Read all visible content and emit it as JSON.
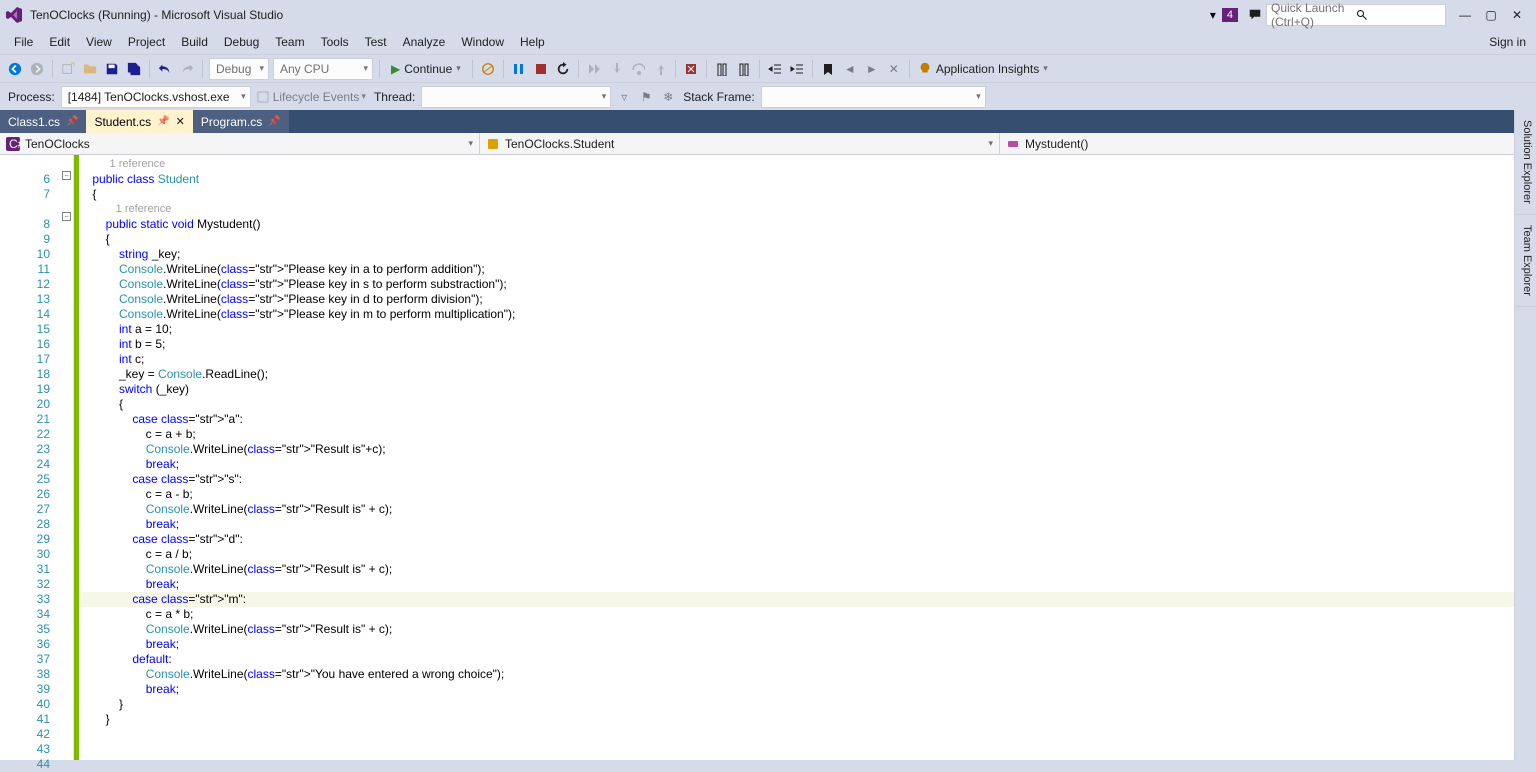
{
  "title": "TenOClocks (Running) - Microsoft Visual Studio",
  "quick_launch_placeholder": "Quick Launch (Ctrl+Q)",
  "notif_count": "4",
  "sign_in": "Sign in",
  "menus": [
    "File",
    "Edit",
    "View",
    "Project",
    "Build",
    "Debug",
    "Team",
    "Tools",
    "Test",
    "Analyze",
    "Window",
    "Help"
  ],
  "toolbar": {
    "config": "Debug",
    "platform": "Any CPU",
    "continue": "Continue",
    "app_insights": "Application Insights"
  },
  "debug_bar": {
    "process_label": "Process:",
    "process_value": "[1484] TenOClocks.vshost.exe",
    "lifecycle": "Lifecycle Events",
    "thread_label": "Thread:",
    "stack_label": "Stack Frame:"
  },
  "tabs": [
    {
      "name": "Class1.cs",
      "active": false
    },
    {
      "name": "Student.cs",
      "active": true
    },
    {
      "name": "Program.cs",
      "active": false
    }
  ],
  "nav": {
    "project": "TenOClocks",
    "class": "TenOClocks.Student",
    "member": "Mystudent()"
  },
  "side_panels": [
    "Solution Explorer",
    "Team Explorer"
  ],
  "line_start": 6,
  "line_end": 44,
  "codelens_ref": "1 reference",
  "code": {
    "l6": "    public class Student",
    "l7": "    {",
    "l8": "        public static void Mystudent()",
    "l9": "        {",
    "l10": "            string _key;",
    "l11": "            Console.WriteLine(\"Please key in a to perform addition\");",
    "l12": "            Console.WriteLine(\"Please key in s to perform substraction\");",
    "l13": "            Console.WriteLine(\"Please key in d to perform division\");",
    "l14": "            Console.WriteLine(\"Please key in m to perform multiplication\");",
    "l15": "            int a = 10;",
    "l16": "            int b = 5;",
    "l17": "            int c;",
    "l18": "            _key = Console.ReadLine();",
    "l19": "",
    "l20": "            switch (_key)",
    "l21": "            {",
    "l22": "                case \"a\":",
    "l23": "                    c = a + b;",
    "l24": "                    Console.WriteLine(\"Result is\"+c);",
    "l25": "                    break;",
    "l26": "                case \"s\":",
    "l27": "                    c = a - b;",
    "l28": "                    Console.WriteLine(\"Result is\" + c);",
    "l29": "                    break;",
    "l30": "                case \"d\":",
    "l31": "                    c = a / b;",
    "l32": "                    Console.WriteLine(\"Result is\" + c);",
    "l33": "                    break;",
    "l34": "                case \"m\":",
    "l35": "                    c = a * b;",
    "l36": "                    Console.WriteLine(\"Result is\" + c);",
    "l37": "                    break;",
    "l38": "                default:",
    "l39": "                    Console.WriteLine(\"You have entered a wrong choice\");",
    "l40": "                    break;",
    "l41": "",
    "l42": "            }",
    "l43": "",
    "l44": "        }"
  }
}
